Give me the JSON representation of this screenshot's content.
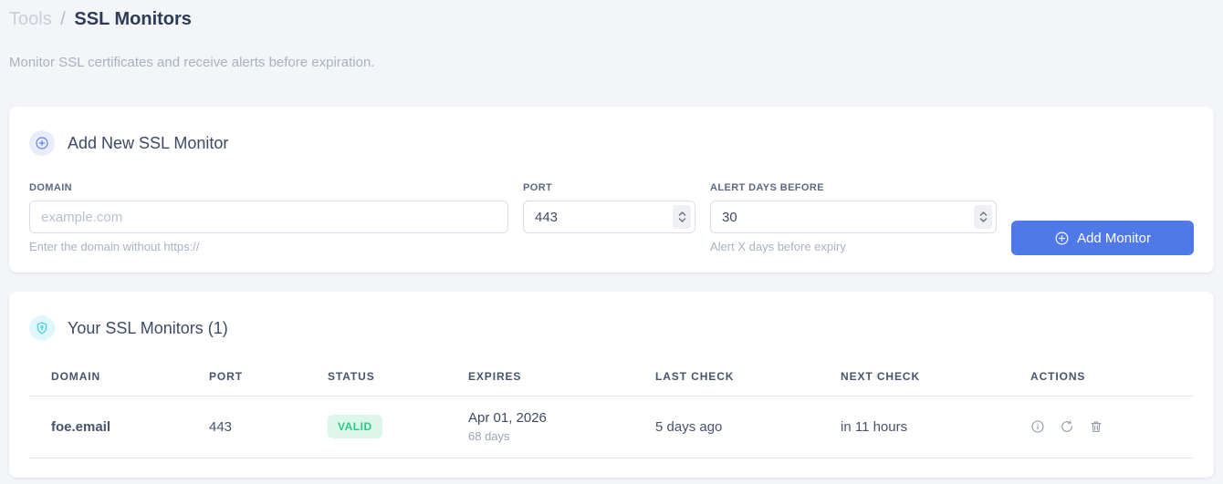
{
  "breadcrumb": {
    "section": "Tools",
    "separator": "/",
    "page": "SSL Monitors"
  },
  "subtitle": "Monitor SSL certificates and receive alerts before expiration.",
  "add_monitor_card": {
    "title": "Add New SSL Monitor",
    "fields": {
      "domain": {
        "label": "DOMAIN",
        "placeholder": "example.com",
        "value": "",
        "helper": "Enter the domain without https://"
      },
      "port": {
        "label": "PORT",
        "value": "443"
      },
      "alert_days": {
        "label": "ALERT DAYS BEFORE",
        "value": "30",
        "helper": "Alert X days before expiry"
      }
    },
    "submit_label": "Add Monitor"
  },
  "monitors_card": {
    "title": "Your SSL Monitors (1)",
    "table": {
      "headers": [
        "DOMAIN",
        "PORT",
        "STATUS",
        "EXPIRES",
        "LAST CHECK",
        "NEXT CHECK",
        "ACTIONS"
      ],
      "rows": [
        {
          "domain": "foe.email",
          "port": "443",
          "status": "VALID",
          "expires_date": "Apr 01, 2026",
          "expires_in": "68 days",
          "last_check": "5 days ago",
          "next_check": "in 11 hours"
        }
      ]
    }
  },
  "icons": {
    "add_header": "plus-circle-icon",
    "list_header": "shield-icon",
    "row_actions": [
      "info-icon",
      "refresh-icon",
      "trash-icon"
    ]
  },
  "colors": {
    "accent_blue": "#5079e8",
    "icon_blue_bg": "#e9edfb",
    "icon_cyan": "#35cfe0",
    "icon_cyan_bg": "#dff6fa",
    "valid_text": "#2bc985",
    "valid_bg": "#ddf6ea",
    "next_check_blue": "#6d95f1",
    "page_bg": "#f3f5f8"
  }
}
